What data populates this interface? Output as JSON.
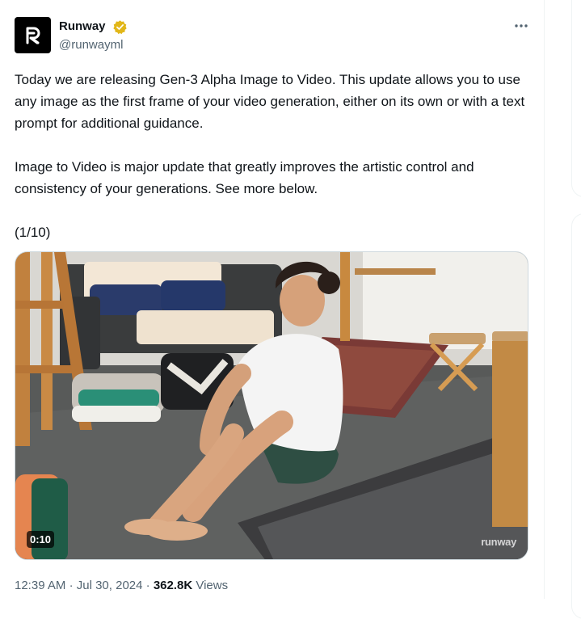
{
  "author": {
    "display_name": "Runway",
    "handle": "@runwayml",
    "verified_color": "#e2b719"
  },
  "tweet": {
    "paragraph1": "Today we are releasing Gen-3 Alpha Image to Video. This update allows you to use any image as the first frame of your video generation, either on its own or with a text prompt for additional guidance.",
    "paragraph2": "Image to Video is major update that greatly improves the artistic control and consistency of your generations. See more below.",
    "paragraph3": "(1/10)"
  },
  "media": {
    "duration": "0:10",
    "watermark": "runway"
  },
  "meta": {
    "time": "12:39 AM",
    "date": "Jul 30, 2024",
    "separator": "·",
    "views_count": "362.8K",
    "views_label": "Views"
  },
  "icons": {
    "avatar": "runway-logo-icon",
    "verified": "verified-badge-icon",
    "more": "more-options-icon"
  }
}
